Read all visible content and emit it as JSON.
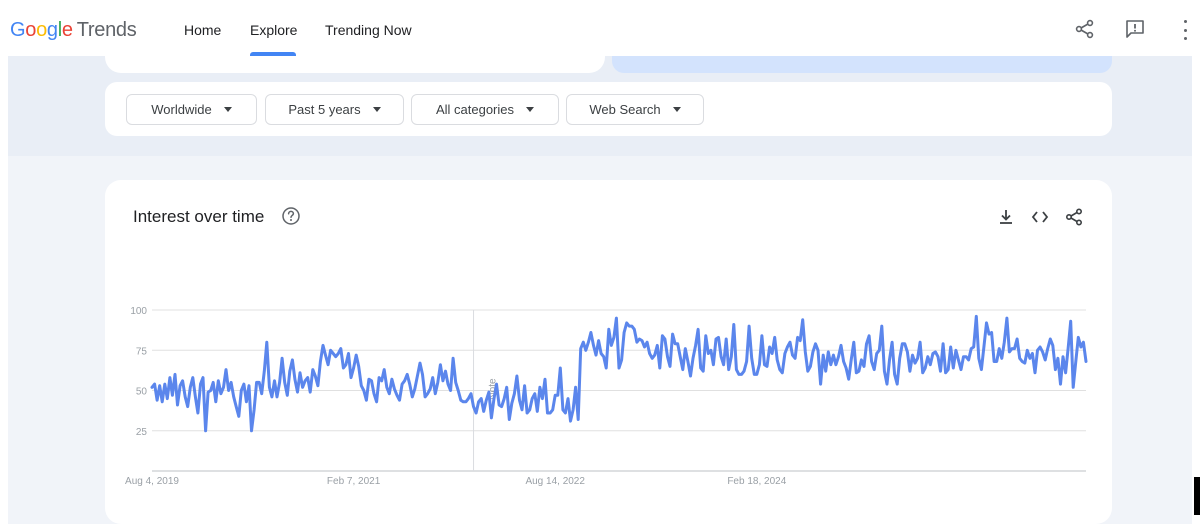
{
  "app": {
    "logo_google": "Google",
    "logo_trends": "Trends"
  },
  "nav": {
    "items": [
      "Home",
      "Explore",
      "Trending Now"
    ],
    "active": "Explore"
  },
  "top_icons": [
    "share-icon",
    "feedback-icon",
    "more-vert-icon"
  ],
  "filters": {
    "region": "Worldwide",
    "time_range": "Past 5 years",
    "category": "All categories",
    "search_type": "Web Search"
  },
  "card": {
    "title": "Interest over time",
    "icons": [
      "help-icon",
      "download-icon",
      "embed-icon",
      "share-icon"
    ]
  },
  "chart_data": {
    "type": "line",
    "title": "Interest over time",
    "xlabel": "",
    "ylabel": "",
    "ylim": [
      0,
      100
    ],
    "yticks": [
      25,
      50,
      75,
      100
    ],
    "x_tick_labels": [
      "Aug 4, 2019",
      "Feb 7, 2021",
      "Aug 14, 2022",
      "Feb 18, 2024"
    ],
    "x_start": "2019-08-04",
    "interval_days": 7,
    "annotation": "Note",
    "annotation_x": "2022-01-02",
    "grid": true,
    "color": "#5b86ec",
    "values": [
      52,
      54,
      44,
      53,
      43,
      54,
      45,
      58,
      47,
      60,
      41,
      53,
      56,
      46,
      40,
      52,
      58,
      46,
      36,
      54,
      58,
      25,
      49,
      50,
      55,
      43,
      56,
      48,
      52,
      63,
      50,
      55,
      46,
      40,
      34,
      50,
      54,
      43,
      53,
      25,
      38,
      55,
      55,
      48,
      62,
      80,
      52,
      46,
      56,
      46,
      55,
      70,
      55,
      47,
      62,
      69,
      57,
      49,
      61,
      52,
      56,
      58,
      49,
      63,
      59,
      53,
      68,
      78,
      72,
      66,
      75,
      73,
      71,
      73,
      76,
      64,
      66,
      73,
      58,
      64,
      72,
      65,
      53,
      50,
      44,
      57,
      56,
      48,
      43,
      58,
      56,
      63,
      52,
      48,
      57,
      51,
      47,
      44,
      54,
      56,
      60,
      54,
      46,
      51,
      59,
      67,
      60,
      46,
      48,
      51,
      58,
      48,
      55,
      66,
      56,
      62,
      54,
      50,
      70,
      55,
      50,
      44,
      43,
      43,
      45,
      48,
      40,
      36,
      43,
      45,
      37,
      44,
      49,
      33,
      45,
      54,
      41,
      40,
      45,
      52,
      32,
      42,
      48,
      59,
      44,
      38,
      53,
      36,
      38,
      45,
      48,
      37,
      52,
      45,
      57,
      36,
      36,
      38,
      47,
      47,
      64,
      38,
      36,
      45,
      31,
      38,
      52,
      32,
      76,
      80,
      75,
      80,
      86,
      78,
      72,
      81,
      73,
      71,
      64,
      88,
      78,
      83,
      95,
      64,
      69,
      86,
      92,
      90,
      90,
      88,
      80,
      82,
      81,
      77,
      80,
      73,
      70,
      72,
      78,
      64,
      84,
      82,
      71,
      65,
      85,
      79,
      79,
      71,
      63,
      76,
      68,
      59,
      70,
      78,
      88,
      64,
      62,
      84,
      73,
      75,
      66,
      82,
      83,
      71,
      66,
      82,
      63,
      71,
      91,
      63,
      60,
      60,
      62,
      68,
      90,
      70,
      60,
      60,
      66,
      84,
      66,
      65,
      77,
      73,
      83,
      69,
      63,
      61,
      73,
      77,
      80,
      72,
      70,
      83,
      81,
      94,
      74,
      62,
      65,
      74,
      79,
      75,
      54,
      72,
      62,
      74,
      66,
      72,
      66,
      71,
      78,
      68,
      64,
      57,
      69,
      80,
      61,
      62,
      69,
      65,
      79,
      84,
      68,
      63,
      73,
      75,
      90,
      62,
      54,
      69,
      80,
      60,
      54,
      70,
      79,
      79,
      74,
      62,
      72,
      67,
      70,
      80,
      61,
      64,
      71,
      66,
      73,
      74,
      71,
      62,
      79,
      61,
      63,
      77,
      64,
      75,
      69,
      63,
      71,
      71,
      69,
      76,
      77,
      96,
      70,
      63,
      77,
      92,
      85,
      86,
      68,
      68,
      76,
      70,
      80,
      95,
      74,
      76,
      76,
      82,
      70,
      68,
      67,
      75,
      70,
      73,
      61,
      75,
      77,
      74,
      69,
      76,
      82,
      78,
      63,
      70,
      54,
      71,
      61,
      76,
      93,
      52,
      68,
      83,
      77,
      80,
      68
    ]
  }
}
